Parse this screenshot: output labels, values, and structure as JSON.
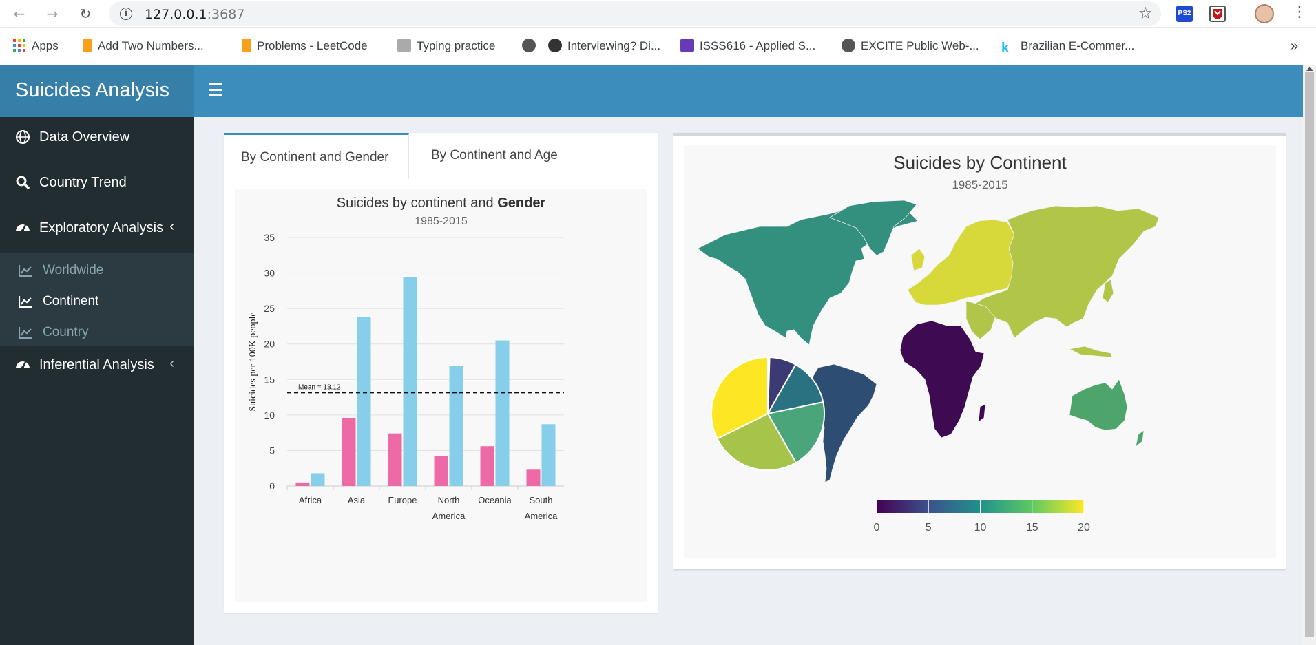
{
  "browser": {
    "url_host": "127.0.0.1",
    "url_port": ":3687",
    "bookmarks": [
      {
        "label": "Apps",
        "color": "#ea4335"
      },
      {
        "label": "Add Two Numbers...",
        "color": "#f89f1b"
      },
      {
        "label": "Problems - LeetCode",
        "color": "#f89f1b"
      },
      {
        "label": "Typing practice",
        "color": "#999999"
      },
      {
        "label": "",
        "color": "#555555"
      },
      {
        "label": "Interviewing? Di...",
        "color": "#333333"
      },
      {
        "label": "ISSS616 - Applied S...",
        "color": "#673ab7"
      },
      {
        "label": "EXCITE Public Web-...",
        "color": "#555555"
      },
      {
        "label": "Brazilian E-Commer...",
        "color": "#20beff"
      }
    ],
    "more": "»",
    "extension_ps2": "PS2"
  },
  "app": {
    "title": "Suicides Analysis",
    "header_color": "#3c8dbc"
  },
  "sidebar": {
    "items": [
      {
        "label": "Data Overview",
        "icon": "globe-icon"
      },
      {
        "label": "Country Trend",
        "icon": "search-icon"
      },
      {
        "label": "Exploratory Analysis",
        "icon": "dashboard-icon",
        "chevron": "‹"
      },
      {
        "label": "Inferential Analysis",
        "icon": "dashboard-icon",
        "chevron": "‹"
      }
    ],
    "subitems": [
      {
        "label": "Worldwide",
        "icon": "line-chart-icon"
      },
      {
        "label": "Continent",
        "icon": "line-chart-icon",
        "active": true
      },
      {
        "label": "Country",
        "icon": "line-chart-icon"
      }
    ]
  },
  "left_box": {
    "tabs": [
      "By Continent and Gender",
      "By Continent and Age"
    ],
    "active_tab": 0
  },
  "chart_data": [
    {
      "type": "bar",
      "title_prefix": "Suicides by continent and ",
      "title_bold": "Gender",
      "subtitle": "1985-2015",
      "ylabel": "Suicides per 100K people",
      "xlabel": "",
      "ylim": [
        0,
        35
      ],
      "yticks": [
        0,
        5,
        10,
        15,
        20,
        25,
        30,
        35
      ],
      "categories": [
        [
          "Africa"
        ],
        [
          "Asia"
        ],
        [
          "Europe"
        ],
        [
          "North",
          "America"
        ],
        [
          "Oceania"
        ],
        [
          "South",
          "America"
        ]
      ],
      "series": [
        {
          "values": [
            0.5,
            9.6,
            7.4,
            4.2,
            5.6,
            2.3
          ],
          "color": "#ee6aa7"
        },
        {
          "values": [
            1.8,
            23.8,
            29.4,
            16.9,
            20.5,
            8.7
          ],
          "color": "#87ceeb"
        }
      ],
      "reference_line": {
        "value": 13.12,
        "label": "Mean = 13.12"
      },
      "grid": true
    },
    {
      "type": "map",
      "title": "Suicides by Continent",
      "subtitle": "1985-2015",
      "legend": {
        "ticks": [
          0,
          5,
          10,
          15,
          20
        ],
        "range": [
          0,
          20
        ],
        "colors": [
          "#440154",
          "#3b528b",
          "#21918c",
          "#5ec962",
          "#fde725"
        ],
        "position": "bottom-center"
      },
      "regions": [
        {
          "name": "Africa",
          "color": "#3e0a52"
        },
        {
          "name": "South America",
          "color": "#2e4d72"
        },
        {
          "name": "North America",
          "color": "#33907e"
        },
        {
          "name": "Oceania",
          "color": "#4ea56c"
        },
        {
          "name": "Asia",
          "color": "#b1c648"
        },
        {
          "name": "Europe",
          "color": "#d7d83a"
        }
      ]
    },
    {
      "type": "pie",
      "slices": [
        {
          "value": 0.5,
          "color": "#440154"
        },
        {
          "value": 7.7,
          "color": "#3b3a73"
        },
        {
          "value": 13.5,
          "color": "#2a7182"
        },
        {
          "value": 20.0,
          "color": "#4ba57a"
        },
        {
          "value": 26.0,
          "color": "#a6c44a"
        },
        {
          "value": 32.3,
          "color": "#fde725"
        }
      ]
    }
  ]
}
